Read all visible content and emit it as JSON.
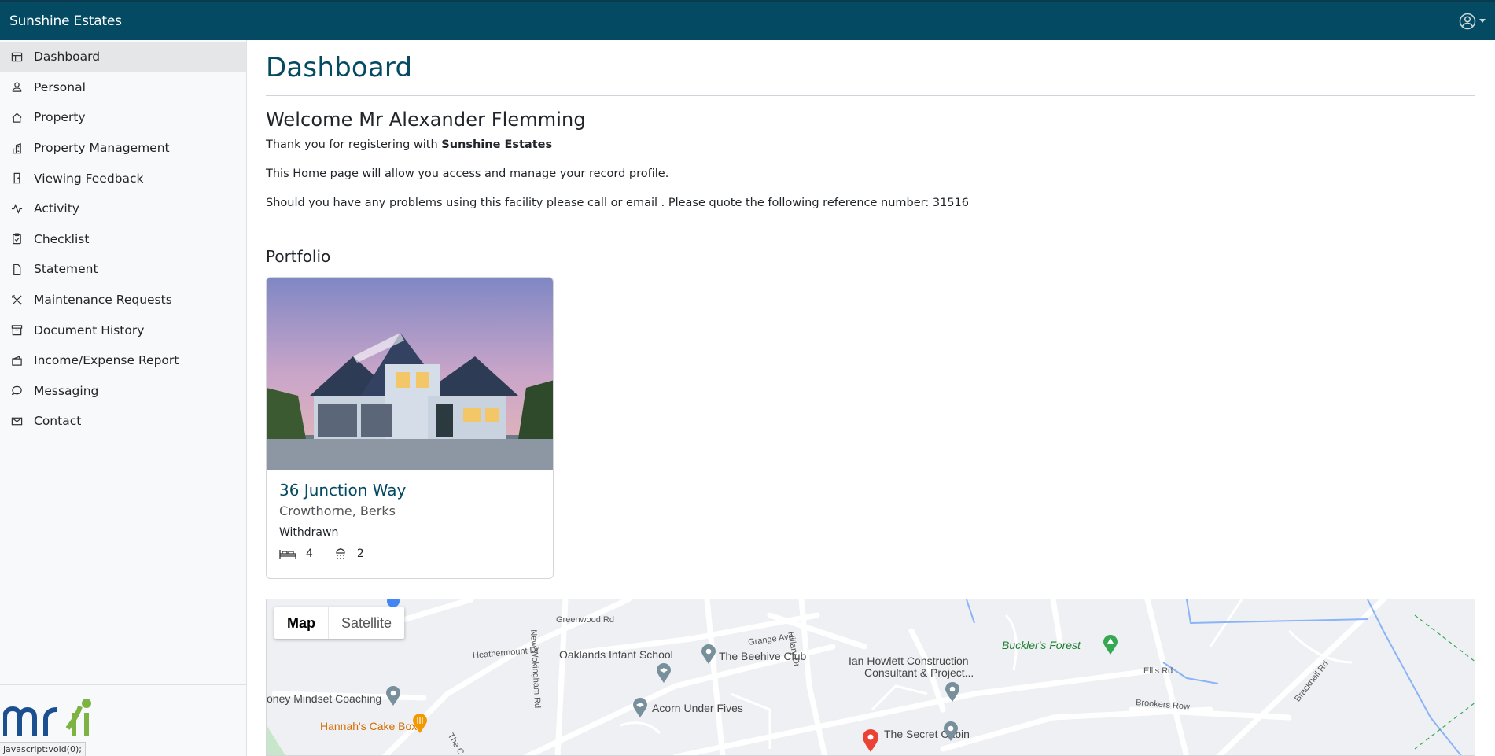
{
  "app": {
    "title": "Sunshine Estates"
  },
  "sidebar": {
    "items": [
      {
        "label": "Dashboard",
        "icon": "dashboard-icon"
      },
      {
        "label": "Personal",
        "icon": "person-icon"
      },
      {
        "label": "Property",
        "icon": "house-icon"
      },
      {
        "label": "Property Management",
        "icon": "buildings-icon"
      },
      {
        "label": "Viewing Feedback",
        "icon": "door-icon"
      },
      {
        "label": "Activity",
        "icon": "activity-icon"
      },
      {
        "label": "Checklist",
        "icon": "clipboard-check-icon"
      },
      {
        "label": "Statement",
        "icon": "file-icon"
      },
      {
        "label": "Maintenance Requests",
        "icon": "tools-icon"
      },
      {
        "label": "Document History",
        "icon": "archive-icon"
      },
      {
        "label": "Income/Expense Report",
        "icon": "wallet-icon"
      },
      {
        "label": "Messaging",
        "icon": "chat-icon"
      },
      {
        "label": "Contact",
        "icon": "envelope-icon"
      }
    ],
    "active_index": 0,
    "logo_text": "mri",
    "status_url": "javascript:void(0);"
  },
  "main": {
    "title": "Dashboard",
    "welcome": "Welcome Mr Alexander Flemming",
    "intro_prefix": "Thank you for registering with ",
    "intro_company": "Sunshine Estates",
    "para2": "This Home page will allow you access and manage your record profile.",
    "para3": "Should you have any problems using this facility please call or email . Please quote the following reference number: 31516",
    "portfolio_title": "Portfolio"
  },
  "property_card": {
    "address": "36 Junction Way",
    "location": "Crowthorne, Berks",
    "status": "Withdrawn",
    "bedrooms": "4",
    "bathrooms": "2"
  },
  "map": {
    "toggle_map": "Map",
    "toggle_satellite": "Satellite",
    "labels": {
      "greenwood": "Greenwood Rd",
      "new_wokingham": "New Wokingham Rd",
      "heathermount": "Heathermount Dr",
      "oaklands": "Oaklands Infant School",
      "beehive": "The Beehive Club",
      "grange": "Grange Ave",
      "hillary": "Hillary Dr",
      "howlett1": "Ian Howlett Construction",
      "howlett2": "Consultant & Project...",
      "ellis": "Ellis Rd",
      "bucklers": "Buckler's Forest",
      "bracknell": "Bracknell Rd",
      "brookers": "Brookers Row",
      "money": "oney Mindset Coaching",
      "cake": "Hannah's Cake Box",
      "acorn": "Acorn Under Fives",
      "cabin": "The Secret Cabin",
      "the": "The C"
    }
  },
  "colors": {
    "primary": "#054a63",
    "sidebar_bg": "#f8f9fa",
    "active_bg": "#e4e6e8"
  }
}
